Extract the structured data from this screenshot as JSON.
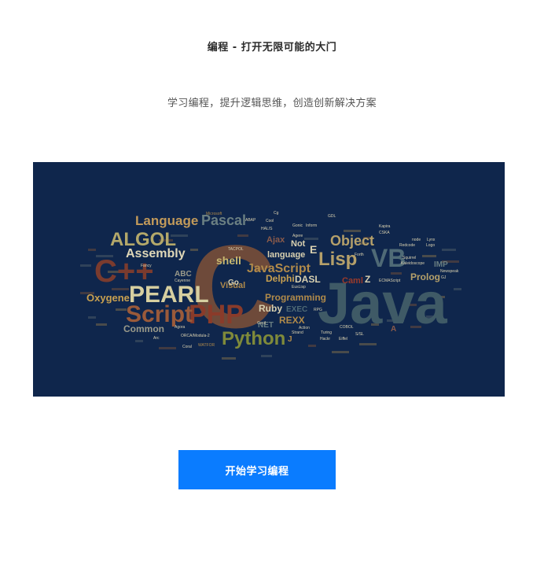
{
  "page": {
    "title": "编程 - 打开无限可能的大门",
    "subtitle": "学习编程，提升逻辑思维，创造创新解决方案"
  },
  "hero": {
    "words": [
      {
        "text": "Java",
        "size": 74,
        "color": "#3f5a66"
      },
      {
        "text": "C",
        "size": 150,
        "color": "#6e4a3a"
      },
      {
        "text": "C++",
        "size": 40,
        "color": "#7a3b2e"
      },
      {
        "text": "PHP",
        "size": 34,
        "color": "#8a3b2a"
      },
      {
        "text": "Script",
        "size": 30,
        "color": "#9a5a3a"
      },
      {
        "text": "PEARL",
        "size": 30,
        "color": "#d7cfa0"
      },
      {
        "text": "ALGOL",
        "size": 24,
        "color": "#b3a86a"
      },
      {
        "text": "Python",
        "size": 24,
        "color": "#7f8a3a"
      },
      {
        "text": "Lisp",
        "size": 24,
        "color": "#b5a06a"
      },
      {
        "text": "VB",
        "size": 32,
        "color": "#4f6a76"
      },
      {
        "text": "Object",
        "size": 18,
        "color": "#b5a06a"
      },
      {
        "text": "Pascal",
        "size": 18,
        "color": "#6a7f82"
      },
      {
        "text": "Language",
        "size": 17,
        "color": "#c29a5a"
      },
      {
        "text": "Assembly",
        "size": 16,
        "color": "#e0d8b8"
      },
      {
        "text": "JavaScript",
        "size": 16,
        "color": "#b08a4a"
      },
      {
        "text": "shell",
        "size": 14,
        "color": "#c8b870"
      },
      {
        "text": "Oxygene",
        "size": 13,
        "color": "#c8a050"
      },
      {
        "text": "Common",
        "size": 12,
        "color": "#9a9a8a"
      },
      {
        "text": "Programming",
        "size": 12,
        "color": "#b08a4a"
      },
      {
        "text": "Ruby",
        "size": 12,
        "color": "#d8d0b0"
      },
      {
        "text": "REXX",
        "size": 12,
        "color": "#b08a4a"
      },
      {
        "text": "DASL",
        "size": 12,
        "color": "#d8d0b0"
      },
      {
        "text": "Delphi",
        "size": 12,
        "color": "#c8a050"
      },
      {
        "text": "Prolog",
        "size": 12,
        "color": "#b5a06a"
      },
      {
        "text": "Visual",
        "size": 11,
        "color": "#b08a4a"
      },
      {
        "text": "language",
        "size": 11,
        "color": "#d8d0b0"
      },
      {
        "text": "Ajax",
        "size": 11,
        "color": "#8a5a4a"
      },
      {
        "text": "Caml",
        "size": 11,
        "color": "#9a3a2a"
      },
      {
        "text": "Not",
        "size": 11,
        "color": "#d8d0b0"
      },
      {
        "text": "ABC",
        "size": 10,
        "color": "#9a9a8a"
      },
      {
        "text": "EXEC",
        "size": 10,
        "color": "#4f6a76"
      },
      {
        "text": "Go",
        "size": 10,
        "color": "#d8d0b0"
      },
      {
        "text": "IMP",
        "size": 10,
        "color": "#6a7f82"
      },
      {
        "text": "NET",
        "size": 10,
        "color": "#6a7f82"
      },
      {
        "text": "E",
        "size": 14,
        "color": "#d8d0b0"
      },
      {
        "text": "Z",
        "size": 12,
        "color": "#d8d0b0"
      },
      {
        "text": "A",
        "size": 10,
        "color": "#8a5a4a"
      },
      {
        "text": "J",
        "size": 10,
        "color": "#b08a4a"
      },
      {
        "text": "Microsoft",
        "size": 5,
        "color": "#b08a4a"
      },
      {
        "text": "ABAP",
        "size": 5,
        "color": "#d8d0b0"
      },
      {
        "text": "Fancy",
        "size": 5,
        "color": "#d8d0b0"
      },
      {
        "text": "Cayenne",
        "size": 5,
        "color": "#d8d0b0"
      },
      {
        "text": "Coral",
        "size": 5,
        "color": "#d8d0b0"
      },
      {
        "text": "WATFOR",
        "size": 5,
        "color": "#b08a4a"
      },
      {
        "text": "Arc",
        "size": 5,
        "color": "#d8d0b0"
      },
      {
        "text": "ORCA/Modula-2",
        "size": 5,
        "color": "#d8d0b0"
      },
      {
        "text": "Agora",
        "size": 5,
        "color": "#d8d0b0"
      },
      {
        "text": "Strand",
        "size": 5,
        "color": "#d8d0b0"
      },
      {
        "text": "COBOL",
        "size": 5,
        "color": "#d8d0b0"
      },
      {
        "text": "Turing",
        "size": 5,
        "color": "#d8d0b0"
      },
      {
        "text": "Eiffel",
        "size": 5,
        "color": "#d8d0b0"
      },
      {
        "text": "S/SL",
        "size": 5,
        "color": "#d8d0b0"
      },
      {
        "text": "Squirrel",
        "size": 5,
        "color": "#d8d0b0"
      },
      {
        "text": "Kaleidoscope",
        "size": 5,
        "color": "#d8d0b0"
      },
      {
        "text": "Newspeak",
        "size": 5,
        "color": "#d8d0b0"
      },
      {
        "text": "GJ",
        "size": 5,
        "color": "#d8d0b0"
      },
      {
        "text": "ECMAScript",
        "size": 5,
        "color": "#d8d0b0"
      },
      {
        "text": "RPG",
        "size": 5,
        "color": "#d8d0b0"
      },
      {
        "text": "EusLisp",
        "size": 5,
        "color": "#d8d0b0"
      },
      {
        "text": "Forth",
        "size": 5,
        "color": "#d8d0b0"
      },
      {
        "text": "Lynx",
        "size": 5,
        "color": "#d8d0b0"
      },
      {
        "text": "Logo",
        "size": 5,
        "color": "#d8d0b0"
      },
      {
        "text": "node",
        "size": 5,
        "color": "#d8d0b0"
      },
      {
        "text": "Redcode",
        "size": 5,
        "color": "#d8d0b0"
      },
      {
        "text": "CSKA",
        "size": 5,
        "color": "#d8d0b0"
      },
      {
        "text": "Kapira",
        "size": 5,
        "color": "#d8d0b0"
      },
      {
        "text": "GDL",
        "size": 5,
        "color": "#d8d0b0"
      },
      {
        "text": "Cool",
        "size": 5,
        "color": "#d8d0b0"
      },
      {
        "text": "Gonic",
        "size": 5,
        "color": "#d8d0b0"
      },
      {
        "text": "Inform",
        "size": 5,
        "color": "#d8d0b0"
      },
      {
        "text": "HAL/S",
        "size": 5,
        "color": "#d8d0b0"
      },
      {
        "text": "TACPOL",
        "size": 5,
        "color": "#d8d0b0"
      },
      {
        "text": "Agere",
        "size": 5,
        "color": "#d8d0b0"
      },
      {
        "text": "Hackr",
        "size": 5,
        "color": "#d8d0b0"
      },
      {
        "text": "Cg",
        "size": 5,
        "color": "#d8d0b0"
      },
      {
        "text": "Action",
        "size": 5,
        "color": "#d8d0b0"
      },
      {
        "text": "Cecil",
        "size": 5,
        "color": "#d8d0b0"
      }
    ]
  },
  "cta": {
    "label": "开始学习编程"
  },
  "colors": {
    "hero_bg": "#0f264c",
    "button_bg": "#0a7cff",
    "button_text": "#ffffff"
  }
}
